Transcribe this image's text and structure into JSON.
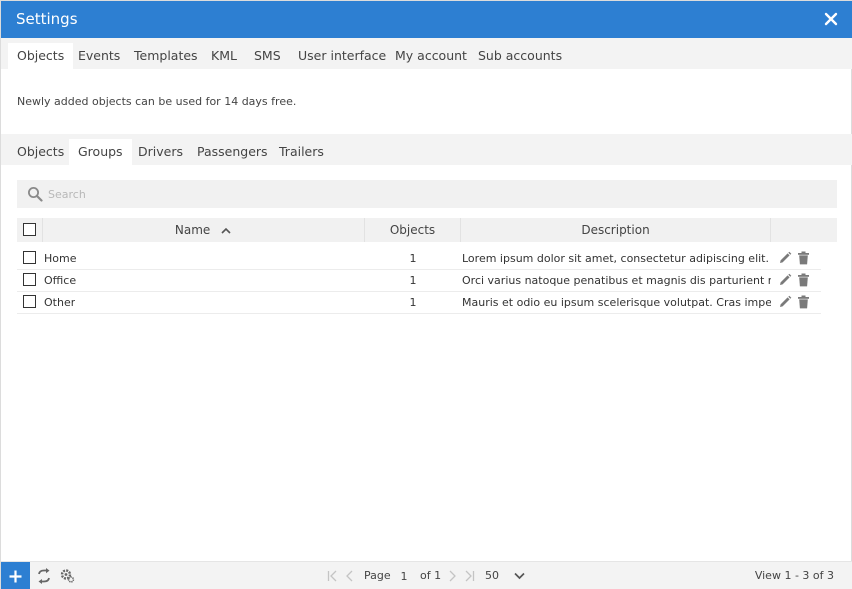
{
  "window": {
    "title": "Settings"
  },
  "main_tabs": [
    {
      "label": "Objects",
      "active": true
    },
    {
      "label": "Events"
    },
    {
      "label": "Templates"
    },
    {
      "label": "KML"
    },
    {
      "label": "SMS"
    },
    {
      "label": "User interface"
    },
    {
      "label": "My account"
    },
    {
      "label": "Sub accounts"
    }
  ],
  "notice": "Newly added objects can be used for 14 days free.",
  "sub_tabs": [
    {
      "label": "Objects"
    },
    {
      "label": "Groups",
      "active": true
    },
    {
      "label": "Drivers"
    },
    {
      "label": "Passengers"
    },
    {
      "label": "Trailers"
    }
  ],
  "search": {
    "placeholder": "Search",
    "value": ""
  },
  "grid": {
    "columns": {
      "name": "Name",
      "objects": "Objects",
      "description": "Description"
    },
    "sort": {
      "column": "Name",
      "direction": "ascending"
    },
    "rows": [
      {
        "name": "Home",
        "objects": "1",
        "description": "Lorem ipsum dolor sit amet, consectetur adipiscing elit. Mor"
      },
      {
        "name": "Office",
        "objects": "1",
        "description": "Orci varius natoque penatibus et magnis dis parturient mont"
      },
      {
        "name": "Other",
        "objects": "1",
        "description": "Mauris et odio eu ipsum scelerisque volutpat. Cras imperdie"
      }
    ]
  },
  "pager": {
    "page_label": "Page",
    "page": "1",
    "of_label": "of 1",
    "page_size": "50",
    "view_info": "View 1 - 3 of 3"
  },
  "icons": {
    "close": "close-icon",
    "search": "search-icon",
    "sort": "chevron-up-icon",
    "edit": "pencil-icon",
    "delete": "trash-icon",
    "add": "plus-icon",
    "refresh": "refresh-icon",
    "settings": "gear-icon"
  },
  "colors": {
    "accent": "#2d7fd2",
    "panel": "#f3f3f3",
    "header": "#f1f1f1",
    "icon": "#7a7a7a"
  }
}
